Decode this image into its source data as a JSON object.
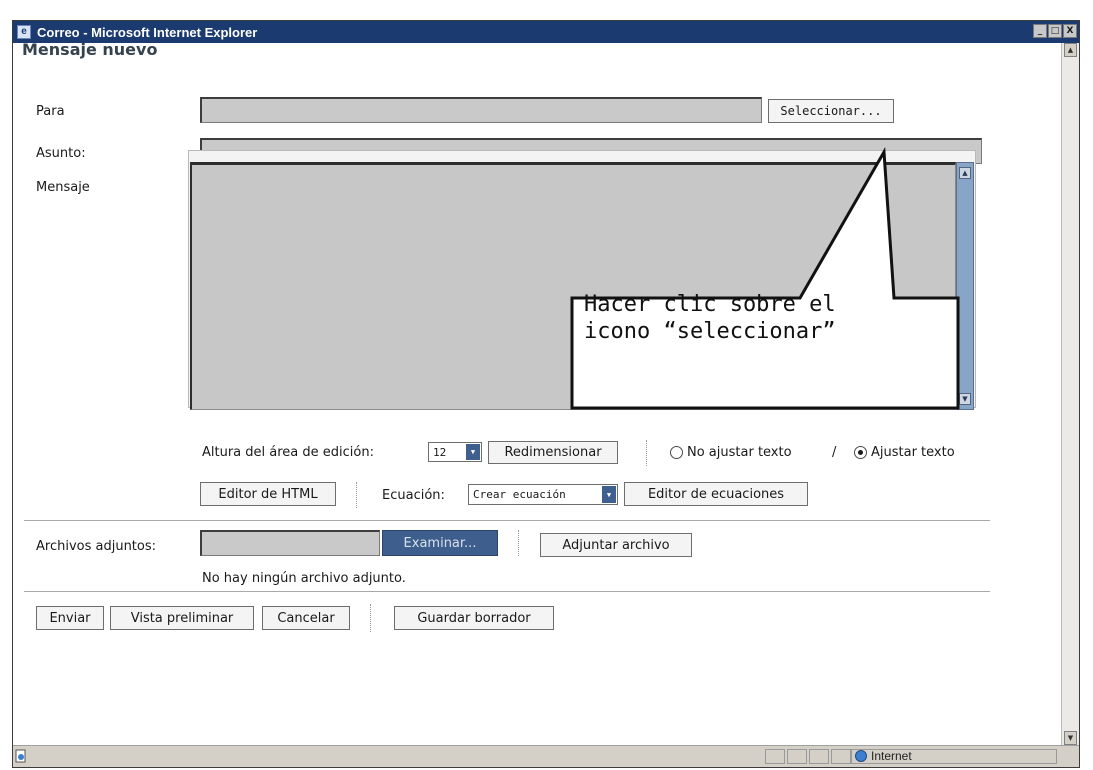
{
  "window": {
    "title": "Correo - Microsoft Internet Explorer",
    "controls": [
      "_",
      "□",
      "X"
    ]
  },
  "page": {
    "heading": "Mensaje nuevo"
  },
  "form": {
    "para_label": "Para",
    "seleccionar_label": "Seleccionar...",
    "asunto_label": "Asunto:",
    "mensaje_label": "Mensaje",
    "altura_label": "Altura del área de edición:",
    "altura_value": "12",
    "redimensionar_label": "Redimensionar",
    "no_ajustar_label": "No ajustar texto",
    "slash": "/",
    "ajustar_label": "Ajustar texto",
    "editor_html_label": "Editor de HTML",
    "ecuacion_label": "Ecuación:",
    "ecuacion_select_value": "Crear ecuación",
    "editor_ecuaciones_label": "Editor de ecuaciones",
    "adjuntos_label": "Archivos adjuntos:",
    "examinar_label": "Examinar...",
    "adjuntar_label": "Adjuntar archivo",
    "no_adjunto_text": "No hay ningún archivo adjunto."
  },
  "actions": {
    "enviar": "Enviar",
    "vista_preliminar": "Vista preliminar",
    "cancelar": "Cancelar",
    "guardar_borrador": "Guardar borrador"
  },
  "callout": {
    "line1": "Hacer clic sobre el",
    "line2": "icono “seleccionar”"
  },
  "statusbar": {
    "zone": "Internet"
  },
  "colors": {
    "titlebar": "#1b3a70",
    "field_gray": "#c9c9c9",
    "examinar_bg": "#3e5f8d"
  }
}
